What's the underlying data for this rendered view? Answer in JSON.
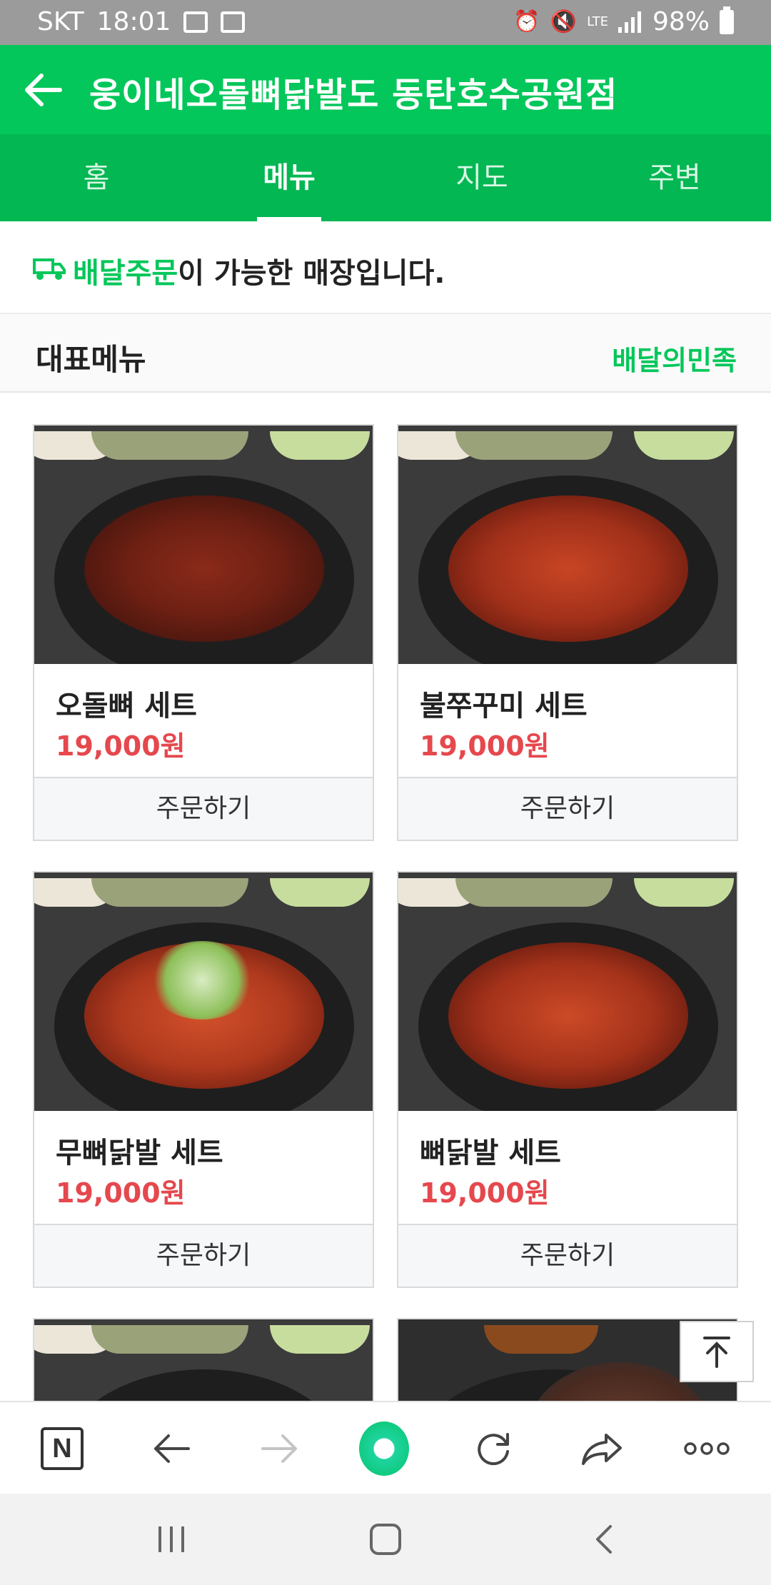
{
  "status_bar": {
    "carrier": "SKT",
    "time": "18:01",
    "network": "LTE",
    "battery": "98%",
    "icons": [
      "gallery-icon",
      "voicemail-icon",
      "alarm-icon",
      "mute-icon",
      "signal-icon",
      "battery-icon"
    ]
  },
  "header": {
    "title": "웅이네오돌뼈닭발도 동탄호수공원점",
    "back_icon": "arrow-left-icon"
  },
  "tabs": [
    {
      "label": "홈",
      "active": false
    },
    {
      "label": "메뉴",
      "active": true
    },
    {
      "label": "지도",
      "active": false
    },
    {
      "label": "주변",
      "active": false
    }
  ],
  "delivery_notice": {
    "highlight": "배달주문",
    "rest": "이 가능한 매장입니다.",
    "icon": "delivery-truck-icon"
  },
  "section": {
    "title": "대표메뉴",
    "link": "배달의민족"
  },
  "menu": [
    {
      "name": "오돌뼈 세트",
      "price": "19,000원",
      "button": "주문하기"
    },
    {
      "name": "불쭈꾸미 세트",
      "price": "19,000원",
      "button": "주문하기"
    },
    {
      "name": "무뼈닭발 세트",
      "price": "19,000원",
      "button": "주문하기"
    },
    {
      "name": "뼈닭발 세트",
      "price": "19,000원",
      "button": "주문하기"
    }
  ],
  "scroll_top_icon": "arrow-up-to-top-icon",
  "browser_toolbar": [
    "naver-home-icon",
    "back-arrow-icon",
    "forward-arrow-icon",
    "green-dot-icon",
    "refresh-icon",
    "share-icon",
    "more-icon"
  ],
  "system_nav": [
    "recents-icon",
    "home-icon",
    "back-icon"
  ],
  "colors": {
    "brand_green": "#03c75a",
    "tab_green": "#03b753",
    "price_red": "#e5484d"
  }
}
